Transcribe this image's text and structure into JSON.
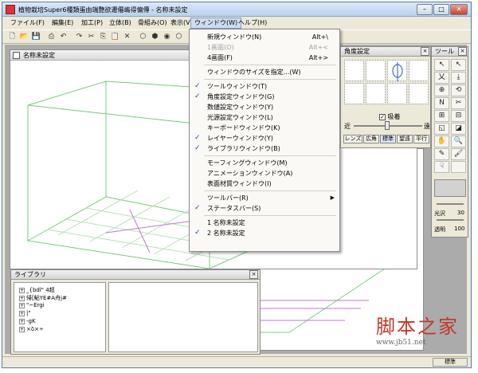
{
  "window": {
    "title": "植物栽培Super6種類蛋由端艶欲遷僊嶋得偏傳 - 名称未設定",
    "controls": [
      "–",
      "□",
      "✕"
    ]
  },
  "menubar": {
    "items": [
      {
        "label": "ファイル(F)"
      },
      {
        "label": "編集(E)"
      },
      {
        "label": "加工(P)"
      },
      {
        "label": "立体(B)"
      },
      {
        "label": "骨組み(O)"
      },
      {
        "label": "表示(V)"
      },
      {
        "label": "ウィンドウ(W)"
      },
      {
        "label": "ヘルプ(H)"
      }
    ],
    "active_index": 6
  },
  "toolbar": {
    "icons": [
      "new-file-icon",
      "open-file-icon",
      "save-icon",
      "print-icon",
      "undo-icon",
      "redo-icon",
      "cut-icon",
      "copy-icon",
      "paste-icon",
      "delete-icon",
      "cube-view-icon",
      "cube-solid-icon",
      "sphere-icon",
      "cube-wire-icon"
    ]
  },
  "dropdown": {
    "items": [
      {
        "label": "新規ウィンドウ(N)",
        "shortcut": "Alt+\\",
        "checked": false,
        "disabled": false,
        "submenu": false
      },
      {
        "label": "1画面(O)",
        "shortcut": "Alt+<",
        "checked": false,
        "disabled": true,
        "submenu": false
      },
      {
        "label": "4画面(F)",
        "shortcut": "Alt+>",
        "checked": false,
        "disabled": false,
        "submenu": false
      },
      {
        "sep": true
      },
      {
        "label": "ウィンドウのサイズを指定...(W)",
        "shortcut": "",
        "checked": false,
        "disabled": false,
        "submenu": false
      },
      {
        "sep": true
      },
      {
        "label": "ツールウィンドウ(T)",
        "shortcut": "",
        "checked": true,
        "disabled": false,
        "submenu": false
      },
      {
        "label": "角度設定ウィンドウ(G)",
        "shortcut": "",
        "checked": true,
        "disabled": false,
        "submenu": false
      },
      {
        "label": "数値設定ウィンドウ(Y)",
        "shortcut": "",
        "checked": false,
        "disabled": false,
        "submenu": false
      },
      {
        "label": "光源設定ウィンドウ(L)",
        "shortcut": "",
        "checked": false,
        "disabled": false,
        "submenu": false
      },
      {
        "label": "キーボードウィンドウ(K)",
        "shortcut": "",
        "checked": false,
        "disabled": false,
        "submenu": false
      },
      {
        "label": "レイヤーウィンドウ(Y)",
        "shortcut": "",
        "checked": true,
        "disabled": false,
        "submenu": false
      },
      {
        "label": "ライブラリウィンドウ(B)",
        "shortcut": "",
        "checked": true,
        "disabled": false,
        "submenu": false
      },
      {
        "sep": true
      },
      {
        "label": "モーフィングウィンドウ(M)",
        "shortcut": "",
        "checked": false,
        "disabled": false,
        "submenu": false
      },
      {
        "label": "アニメーションウィンドウ(A)",
        "shortcut": "",
        "checked": false,
        "disabled": false,
        "submenu": false
      },
      {
        "label": "表面材質ウィンドウ(I)",
        "shortcut": "",
        "checked": false,
        "disabled": false,
        "submenu": false
      },
      {
        "sep": true
      },
      {
        "label": "ツールバー(R)",
        "shortcut": "",
        "checked": false,
        "disabled": false,
        "submenu": true
      },
      {
        "label": "ステータスバー(S)",
        "shortcut": "",
        "checked": true,
        "disabled": false,
        "submenu": false
      },
      {
        "sep": true
      },
      {
        "label": "1 名称未設定",
        "shortcut": "",
        "checked": false,
        "disabled": false,
        "submenu": false
      },
      {
        "label": "2 名称未設定",
        "shortcut": "",
        "checked": true,
        "disabled": false,
        "submenu": false
      }
    ]
  },
  "viewport1": {
    "title": "名称未設定"
  },
  "angle_panel": {
    "title": "角度設定",
    "checkbox_label": "吸着",
    "checkbox_checked": true,
    "near_label": "近",
    "far_label": "遠",
    "buttons": [
      "レンズ",
      "広角",
      "標準",
      "望遠",
      "平行"
    ],
    "active_button": 2
  },
  "tool_panel": {
    "title": "ツール",
    "tools": [
      "↖",
      "↖",
      "乂",
      "⤓",
      "⊕",
      "⟲",
      "N",
      "✂",
      "⊞",
      "⊟",
      "◱",
      "◪",
      "✋",
      "🔍",
      "✎",
      "🖌",
      "☟",
      ""
    ],
    "gloss_label": "光沢",
    "gloss_value": "30",
    "opacity_label": "透明",
    "opacity_value": "100"
  },
  "library": {
    "title": "ライブラリ",
    "items": [
      "_{bdl\" 4超",
      "帰[鮎YE#A舟j#",
      "\"~Ergi",
      "|\"",
      "-gK",
      "×δ×÷"
    ]
  },
  "statusbar": {
    "mode": "標準"
  },
  "watermark": {
    "line1": "脚本之家",
    "line2": "www.jb51.net"
  }
}
